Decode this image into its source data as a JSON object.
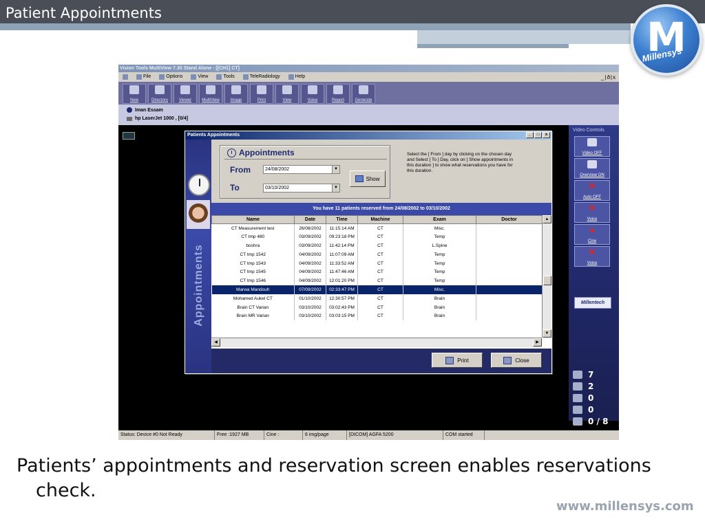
{
  "slide": {
    "title": "Patient Appointments",
    "caption": "Patients’ appointments and reservation screen enables reservations check.",
    "footer_url": "www.millensys.com",
    "logo_letter": "M",
    "logo_text": "Millensys"
  },
  "app": {
    "title": "Vision Tools MultiView 7.30 Stand Alone - [[CH1] CT]",
    "menu": [
      "File",
      "Options",
      "View",
      "Tools",
      "TeleRadiology",
      "Help"
    ],
    "window_controls": "_|ð|x",
    "toolbar": [
      "New",
      "Directory",
      "Viewer",
      "MultiView",
      "Image",
      "Print",
      "View",
      "Voice",
      "Report",
      "Generate"
    ],
    "patient_name": "Iman Essam",
    "printer": "hp LaserJet 1000 , [0/4]"
  },
  "video_panel": {
    "title": "Video Controls",
    "buttons": [
      "Video OFF",
      "Overview ON",
      "Auto OFF",
      "Voice",
      "Cine",
      "Voice"
    ],
    "brand": "Millentech"
  },
  "stats": [
    {
      "icon": "image-stack-icon",
      "value": "7"
    },
    {
      "icon": "film-strip-icon",
      "value": "2"
    },
    {
      "icon": "voice-icon",
      "value": "0"
    },
    {
      "icon": "document-icon",
      "value": "0"
    },
    {
      "icon": "grid-icon",
      "value": "0 / 8"
    }
  ],
  "status_bar": [
    "Status: Device #0 Not Ready",
    "Free :1927 MB",
    "Cine :",
    "6 img/page",
    "[DICOM] AGFA 5200",
    "COM started"
  ],
  "dialog": {
    "title": "Patients Appointments",
    "controls": [
      "_",
      "□",
      "x"
    ],
    "vertical_label": "Appointments",
    "heading": "Appointments",
    "from_label": "From",
    "from_value": "24/08/2002",
    "to_label": "To",
    "to_value": "03/10/2002",
    "show_label": "Show",
    "help_text": "Select the [ From ] day by clicking on the chosen day and Select [ To ] Day, click on [ Show appointments in this duration ] to show what reservations you have for this duration.",
    "banner": "You have 11 patients reserved from 24/08/2002 to 03/10/2002",
    "columns": [
      "Name",
      "Date",
      "Time",
      "Machine",
      "Exam",
      "Doctor"
    ],
    "rows": [
      {
        "name": "CT Measurement test",
        "date": "26/08/2002",
        "time": "11:15:14 AM",
        "machine": "CT",
        "exam": "Misc.",
        "doctor": ""
      },
      {
        "name": "CT tmp 480",
        "date": "03/09/2002",
        "time": "09:23:18 PM",
        "machine": "CT",
        "exam": "Temp",
        "doctor": ""
      },
      {
        "name": "boshra",
        "date": "03/09/2002",
        "time": "11:42:14 PM",
        "machine": "CT",
        "exam": "L.Spine",
        "doctor": ""
      },
      {
        "name": "CT tmp 1542",
        "date": "04/09/2002",
        "time": "11:07:09 AM",
        "machine": "CT",
        "exam": "Temp",
        "doctor": ""
      },
      {
        "name": "CT tmp 1543",
        "date": "04/09/2002",
        "time": "11:33:52 AM",
        "machine": "CT",
        "exam": "Temp",
        "doctor": ""
      },
      {
        "name": "CT tmp 1545",
        "date": "04/09/2002",
        "time": "11:47:46 AM",
        "machine": "CT",
        "exam": "Temp",
        "doctor": ""
      },
      {
        "name": "CT tmp 1546",
        "date": "04/09/2002",
        "time": "12:01:20 PM",
        "machine": "CT",
        "exam": "Temp",
        "doctor": ""
      },
      {
        "name": "Marwa Mandouh",
        "date": "07/09/2002",
        "time": "02:33:47 PM",
        "machine": "CT",
        "exam": "Misc.",
        "doctor": ""
      },
      {
        "name": "Mohamed Aukel CT",
        "date": "01/10/2002",
        "time": "12:30:57 PM",
        "machine": "CT",
        "exam": "Brain",
        "doctor": ""
      },
      {
        "name": "Brain CT Varian",
        "date": "03/10/2002",
        "time": "03:02:43 PM",
        "machine": "CT",
        "exam": "Brain",
        "doctor": ""
      },
      {
        "name": "Brain MR Varian",
        "date": "03/10/2002",
        "time": "03:03:15 PM",
        "machine": "CT",
        "exam": "Brain",
        "doctor": ""
      }
    ],
    "selected_row": 7,
    "print_label": "Print",
    "close_label": "Close"
  },
  "colors": {
    "header_bar": "#4a4f57",
    "accent_band": "#8fa3b7",
    "app_navy": "#3b4aa8",
    "selection": "#0a246a"
  }
}
